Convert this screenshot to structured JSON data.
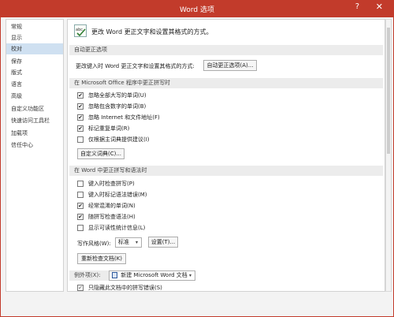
{
  "window": {
    "title": "Word 选项",
    "help": "?",
    "close": "✕"
  },
  "sidebar": {
    "items": [
      {
        "label": "常规"
      },
      {
        "label": "显示"
      },
      {
        "label": "校对",
        "active": true
      },
      {
        "label": "保存"
      },
      {
        "label": "版式"
      },
      {
        "label": "语言"
      },
      {
        "label": "高级"
      },
      {
        "label": "自定义功能区"
      },
      {
        "label": "快速访问工具栏"
      },
      {
        "label": "加载项"
      },
      {
        "label": "信任中心"
      }
    ]
  },
  "header": {
    "text": "更改 Word 更正文字和设置其格式的方式。"
  },
  "autocorrect": {
    "section": "自动更正选项",
    "label": "更改键入时 Word 更正文字和设置其格式的方式:",
    "button": "自动更正选项(A)..."
  },
  "office_spell": {
    "section": "在 Microsoft Office 程序中更正拼写时",
    "checks": [
      {
        "label": "忽略全部大写的单词(U)",
        "checked": true
      },
      {
        "label": "忽略包含数字的单词(B)",
        "checked": true
      },
      {
        "label": "忽略 Internet 和文件地址(F)",
        "checked": true
      },
      {
        "label": "标记重复单词(R)",
        "checked": true
      },
      {
        "label": "仅根据主词典提供建议(I)",
        "checked": false
      }
    ],
    "dict_button": "自定义词典(C)..."
  },
  "word_spell": {
    "section": "在 Word 中更正拼写和语法时",
    "checks": [
      {
        "label": "键入时检查拼写(P)",
        "checked": false
      },
      {
        "label": "键入时标记语法错误(M)",
        "checked": false
      },
      {
        "label": "经常混淆的单词(N)",
        "checked": true
      },
      {
        "label": "随拼写检查语法(H)",
        "checked": true
      },
      {
        "label": "显示可读性统计信息(L)",
        "checked": false
      }
    ],
    "style_label": "写作风格(W):",
    "style_value": "标准",
    "settings_button": "设置(T)...",
    "recheck_button": "重新检查文档(K)"
  },
  "exceptions": {
    "label": "例外项(X):",
    "doc_value": "新建 Microsoft Word 文档",
    "hide_label": "只隐藏此文档中的拼写错误(S)",
    "hide_checked": true
  },
  "icons": {
    "checkmark": "✔",
    "dropdown": "▾"
  }
}
